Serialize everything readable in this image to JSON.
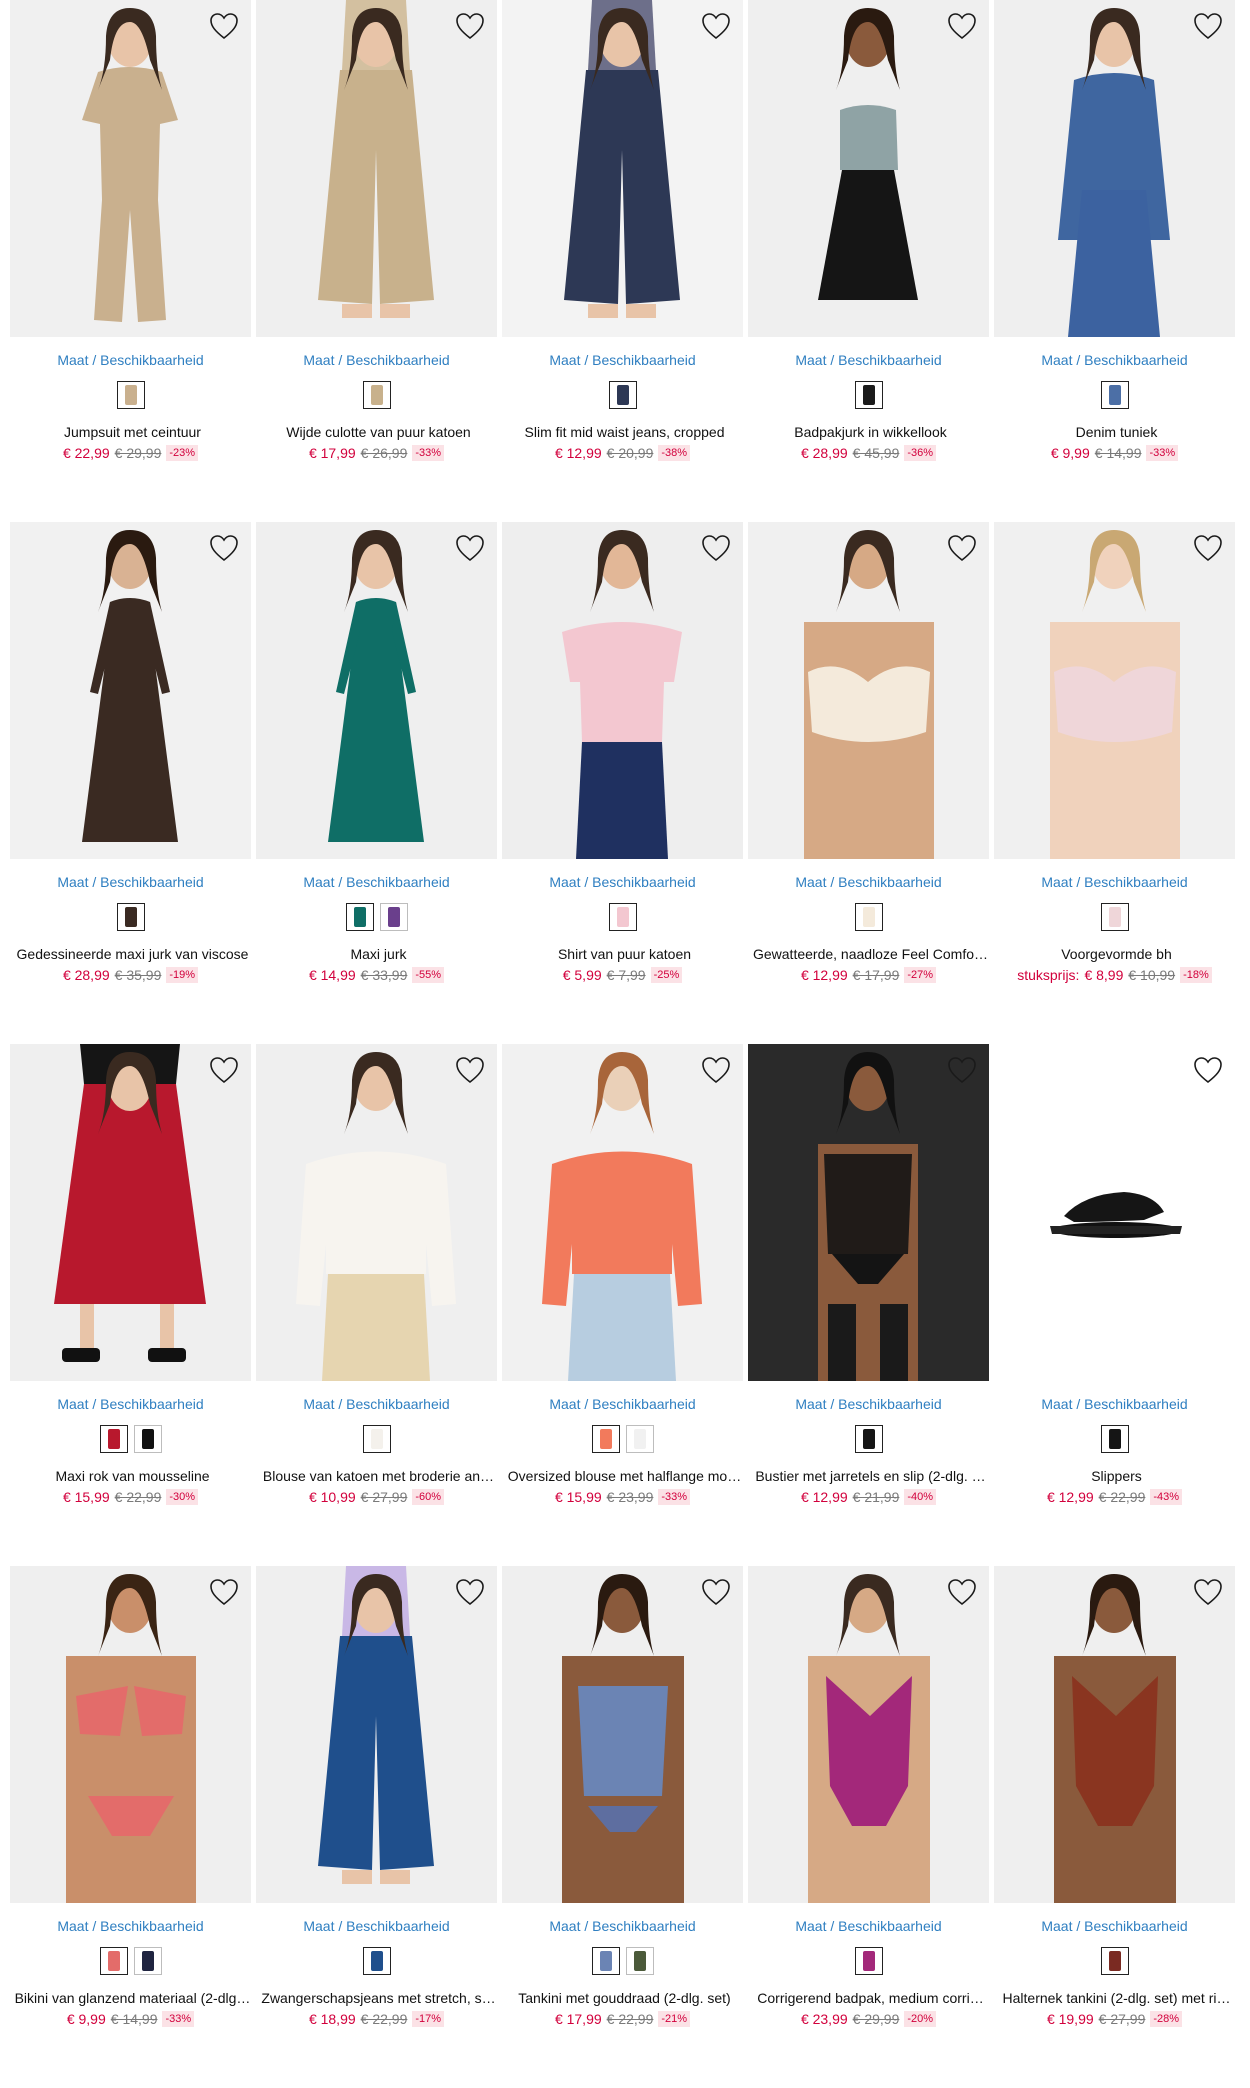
{
  "ui": {
    "availability_label": "Maat / Beschikbaarheid",
    "colors": {
      "price": "#d2003c",
      "link": "#2f7fc1",
      "discount_bg": "#fbe2e6"
    }
  },
  "products": [
    {
      "name": "Jumpsuit met ceintuur",
      "price": "€ 22,99",
      "old": "€ 29,99",
      "discount": "-23%",
      "swatches": [
        "#c9b08e"
      ],
      "icon": "heart-icon"
    },
    {
      "name": "Wijde culotte van puur katoen",
      "price": "€ 17,99",
      "old": "€ 26,99",
      "discount": "-33%",
      "swatches": [
        "#c8b18c"
      ],
      "icon": "heart-icon"
    },
    {
      "name": "Slim fit mid waist jeans, cropped",
      "price": "€ 12,99",
      "old": "€ 20,99",
      "discount": "-38%",
      "swatches": [
        "#2d3855"
      ],
      "icon": "heart-icon"
    },
    {
      "name": "Badpakjurk in wikkellook",
      "price": "€ 28,99",
      "old": "€ 45,99",
      "discount": "-36%",
      "swatches": [
        "#1b1b1b"
      ],
      "icon": "heart-icon"
    },
    {
      "name": "Denim tuniek",
      "price": "€ 9,99",
      "old": "€ 14,99",
      "discount": "-33%",
      "swatches": [
        "#4c6fa6"
      ],
      "icon": "heart-icon"
    },
    {
      "name": "Gedessineerde maxi jurk van viscose",
      "price": "€ 28,99",
      "old": "€ 35,99",
      "discount": "-19%",
      "swatches": [
        "#3a2a22"
      ],
      "icon": "heart-icon"
    },
    {
      "name": "Maxi jurk",
      "price": "€ 14,99",
      "old": "€ 33,99",
      "discount": "-55%",
      "swatches": [
        "#0f6e66",
        "#6a3f8c"
      ],
      "icon": "heart-icon"
    },
    {
      "name": "Shirt van puur katoen",
      "price": "€ 5,99",
      "old": "€ 7,99",
      "discount": "-25%",
      "swatches": [
        "#f3c7d0"
      ],
      "icon": "heart-icon"
    },
    {
      "name": "Gewatteerde, naadloze Feel Comfo…",
      "price": "€ 12,99",
      "old": "€ 17,99",
      "discount": "-27%",
      "swatches": [
        "#f4eadb"
      ],
      "icon": "heart-icon"
    },
    {
      "name": "Voorgevormde bh",
      "prefix": "stuksprijs:",
      "price": "€ 8,99",
      "old": "€ 10,99",
      "discount": "-18%",
      "swatches": [
        "#efd6d9"
      ],
      "icon": "heart-icon"
    },
    {
      "name": "Maxi rok van mousseline",
      "price": "€ 15,99",
      "old": "€ 22,99",
      "discount": "-30%",
      "swatches": [
        "#b8182d",
        "#111111"
      ],
      "icon": "heart-icon"
    },
    {
      "name": "Blouse van katoen met broderie an…",
      "price": "€ 10,99",
      "old": "€ 27,99",
      "discount": "-60%",
      "swatches": [
        "#f4f1ec"
      ],
      "icon": "heart-icon"
    },
    {
      "name": "Oversized blouse met halflange mo…",
      "price": "€ 15,99",
      "old": "€ 23,99",
      "discount": "-33%",
      "swatches": [
        "#f27a5c",
        "#f1f1f1"
      ],
      "icon": "heart-icon"
    },
    {
      "name": "Bustier met jarretels en slip (2-dlg. …",
      "price": "€ 12,99",
      "old": "€ 21,99",
      "discount": "-40%",
      "swatches": [
        "#151515"
      ],
      "icon": "heart-icon"
    },
    {
      "name": "Slippers",
      "price": "€ 12,99",
      "old": "€ 22,99",
      "discount": "-43%",
      "swatches": [
        "#151515"
      ],
      "icon": "heart-icon"
    },
    {
      "name": "Bikini van glanzend materiaal (2-dlg…",
      "price": "€ 9,99",
      "old": "€ 14,99",
      "discount": "-33%",
      "swatches": [
        "#e36c6a",
        "#1f2440"
      ],
      "icon": "heart-icon"
    },
    {
      "name": "Zwangerschapsjeans met stretch, s…",
      "price": "€ 18,99",
      "old": "€ 22,99",
      "discount": "-17%",
      "swatches": [
        "#1f4f8c"
      ],
      "icon": "heart-icon"
    },
    {
      "name": "Tankini met gouddraad (2-dlg. set)",
      "price": "€ 17,99",
      "old": "€ 22,99",
      "discount": "-21%",
      "swatches": [
        "#6b84b4",
        "#4b5a3a"
      ],
      "icon": "heart-icon"
    },
    {
      "name": "Corrigerend badpak, medium corri…",
      "price": "€ 23,99",
      "old": "€ 29,99",
      "discount": "-20%",
      "swatches": [
        "#a3287a"
      ],
      "icon": "heart-icon"
    },
    {
      "name": "Halternek tankini (2-dlg. set) met ri…",
      "price": "€ 19,99",
      "old": "€ 27,99",
      "discount": "-28%",
      "swatches": [
        "#7a2a22"
      ],
      "icon": "heart-icon"
    }
  ]
}
